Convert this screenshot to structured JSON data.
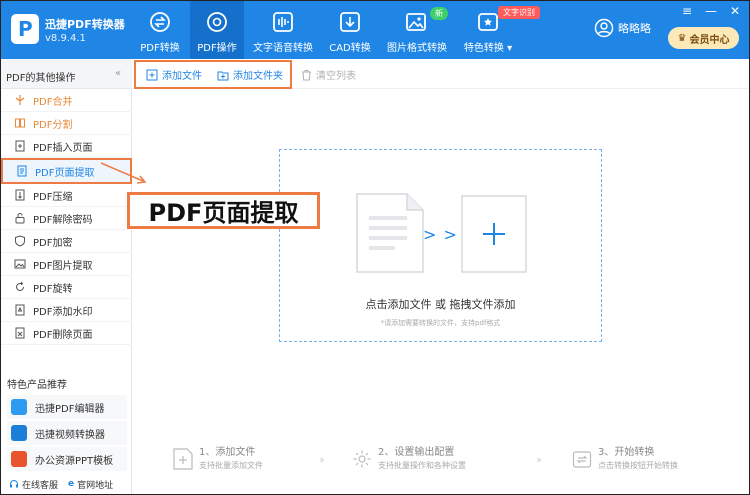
{
  "app": {
    "name": "迅捷PDF转换器",
    "version": "v8.9.4.1"
  },
  "nav": [
    {
      "label": "PDF转换",
      "icon": "convert-icon"
    },
    {
      "label": "PDF操作",
      "icon": "pdf-operate-icon"
    },
    {
      "label": "文字语音转换",
      "icon": "audio-icon"
    },
    {
      "label": "CAD转换",
      "icon": "cad-icon"
    },
    {
      "label": "图片格式转换",
      "icon": "image-icon"
    },
    {
      "label": "特色转换",
      "icon": "special-icon"
    }
  ],
  "active_nav": "PDF操作",
  "badges": {
    "new": "新",
    "hot": "文字识别"
  },
  "user": {
    "name": "略略略",
    "vip_label": "会员中心"
  },
  "window_controls": [
    "≡",
    "—",
    "✕"
  ],
  "sidebar": {
    "header": "PDF的其他操作",
    "items": [
      {
        "label": "PDF合并",
        "icon": "merge-icon"
      },
      {
        "label": "PDF分割",
        "icon": "split-icon"
      },
      {
        "label": "PDF插入页面",
        "icon": "insert-page-icon"
      },
      {
        "label": "PDF页面提取",
        "icon": "extract-page-icon"
      },
      {
        "label": "PDF压缩",
        "icon": "compress-icon"
      },
      {
        "label": "PDF解除密码",
        "icon": "unlock-icon"
      },
      {
        "label": "PDF加密",
        "icon": "encrypt-icon"
      },
      {
        "label": "PDF图片提取",
        "icon": "image-extract-icon"
      },
      {
        "label": "PDF旋转",
        "icon": "rotate-icon"
      },
      {
        "label": "PDF添加水印",
        "icon": "watermark-icon"
      },
      {
        "label": "PDF删除页面",
        "icon": "delete-page-icon"
      }
    ],
    "selected": "PDF页面提取",
    "recommend_title": "特色产品推荐",
    "recommend": [
      {
        "label": "迅捷PDF编辑器",
        "icon": "pdf-editor-logo-icon",
        "color": "#2e9bf0"
      },
      {
        "label": "迅捷视频转换器",
        "icon": "video-converter-logo-icon",
        "color": "#1b7fd8"
      },
      {
        "label": "办公资源PPT模板",
        "icon": "ppt-template-logo-icon",
        "color": "#e8542e"
      }
    ],
    "footer": {
      "service": "在线客服",
      "website": "官网地址"
    }
  },
  "toolbar": {
    "add_file": "添加文件",
    "add_folder": "添加文件夹",
    "clear_list": "清空列表"
  },
  "dropzone": {
    "main": "点击添加文件 或 拖拽文件添加",
    "sub": "*请添加需要转换的文件，支持pdf格式",
    "arrows": "> > >"
  },
  "callout": "PDF页面提取",
  "steps": [
    {
      "title": "1、添加文件",
      "desc": "支持批量添加文件"
    },
    {
      "title": "2、设置输出配置",
      "desc": "支持批量操作和各种设置"
    },
    {
      "title": "3、开始转换",
      "desc": "点击转换按钮开始转换"
    }
  ],
  "colors": {
    "primary": "#1f86e6",
    "highlight": "#ee7b43",
    "vip": "#fde9b7"
  }
}
